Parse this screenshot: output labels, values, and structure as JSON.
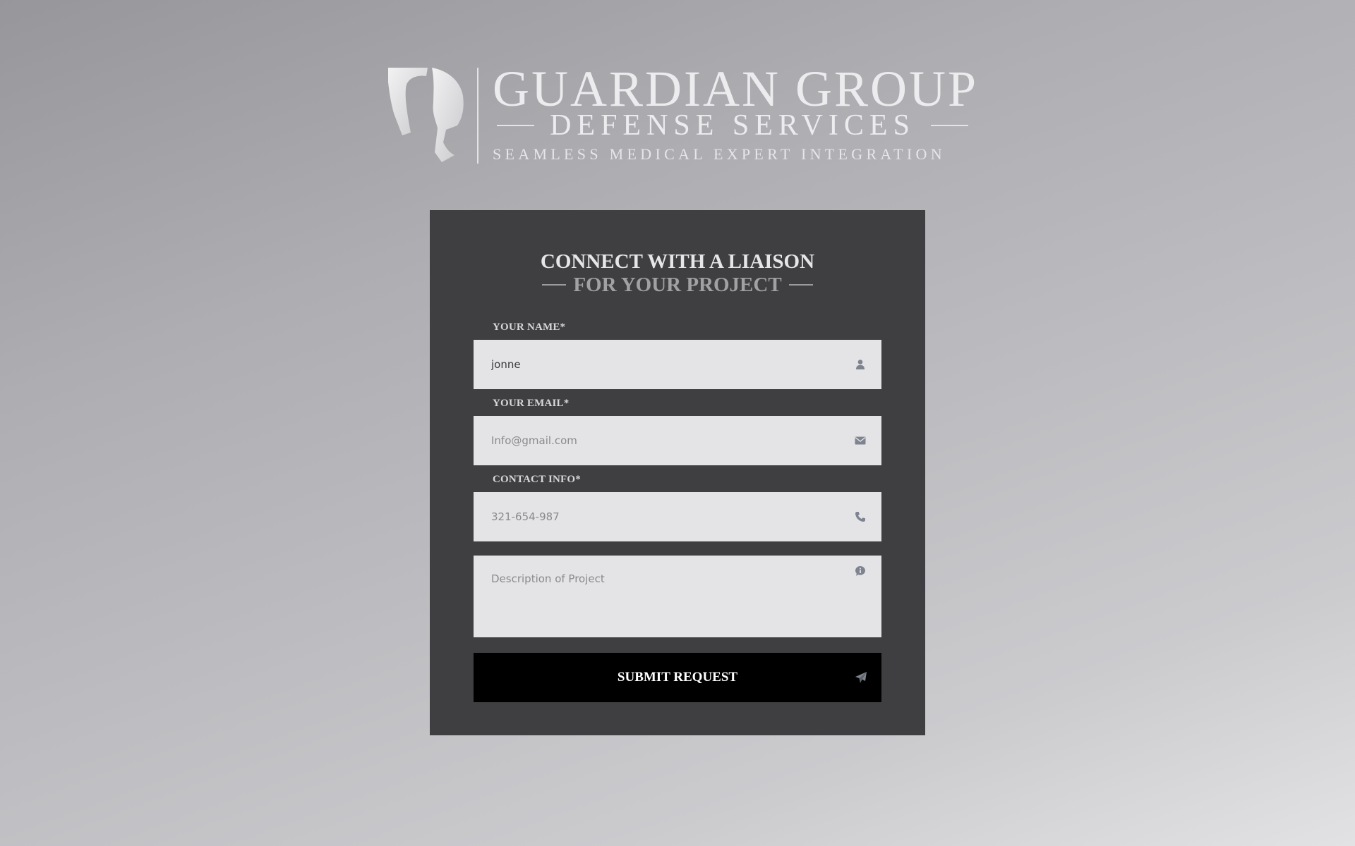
{
  "logo": {
    "title": "GUARDIAN GROUP",
    "subtitle": "DEFENSE SERVICES",
    "tagline": "SEAMLESS MEDICAL EXPERT INTEGRATION",
    "mark_icon": "spartan-helmet-icon"
  },
  "form": {
    "heading": "CONNECT WITH A LIAISON",
    "subheading": "FOR YOUR PROJECT",
    "fields": {
      "name": {
        "label": "YOUR NAME*",
        "value": "jonne",
        "placeholder": "",
        "icon": "user-icon"
      },
      "email": {
        "label": "YOUR EMAIL*",
        "value": "",
        "placeholder": "Info@gmail.com",
        "icon": "envelope-icon"
      },
      "contact": {
        "label": "CONTACT INFO*",
        "value": "",
        "placeholder": "321-654-987",
        "icon": "phone-icon"
      },
      "description": {
        "value": "",
        "placeholder": "Description of Project",
        "icon": "info-bubble-icon"
      }
    },
    "submit": {
      "label": "SUBMIT REQUEST",
      "icon": "paper-plane-icon"
    }
  },
  "colors": {
    "card_background": "#3f3f41",
    "field_background": "#e4e4e6",
    "button_background": "#000000",
    "icon_color": "#7e848f"
  }
}
